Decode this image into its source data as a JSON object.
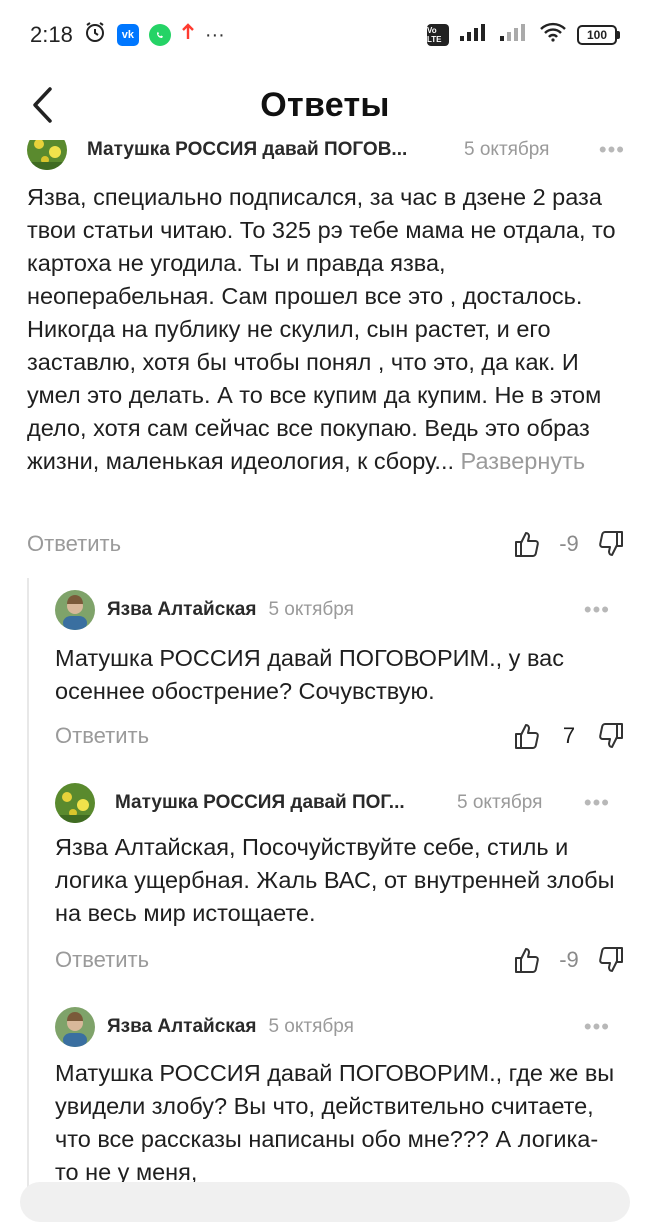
{
  "status_bar": {
    "time": "2:18",
    "more": "···",
    "battery": "100",
    "lte": "Vo LTE"
  },
  "header": {
    "title": "Ответы"
  },
  "comments": [
    {
      "author": "Матушка РОССИЯ давай ПОГОВ...",
      "date": "5 октября",
      "text": "Язва, специально подписался, за час в дзене 2 раза твои статьи читаю. То 325 рэ тебе мама не отдала, то картоха не угодила. Ты и правда язва, неоперабельная. Сам прошел все это , досталось. Никогда на публику не скулил, сын растет, и его заставлю, хотя бы чтобы понял , что это, да как. И умел это делать. А то все купим да купим. Не в этом дело, хотя сам сейчас все покупаю. Ведь это образ жизни, маленькая идеология, к сбору...",
      "expand": "Развернуть",
      "reply": "Ответить",
      "score": "-9"
    },
    {
      "author": "Язва Алтайская",
      "date": "5 октября",
      "text": "Матушка РОССИЯ давай ПОГОВОРИМ., у вас осеннее обострение? Сочувствую.",
      "reply": "Ответить",
      "score": "7"
    },
    {
      "author": "Матушка РОССИЯ давай ПОГ...",
      "date": "5 октября",
      "text": "Язва Алтайская, Посочуйствуйте себе, стиль и логика ущербная. Жаль ВАС, от внутренней злобы на весь мир истощаете.",
      "reply": "Ответить",
      "score": "-9"
    },
    {
      "author": "Язва Алтайская",
      "date": "5 октября",
      "text": "Матушка РОССИЯ давай ПОГОВОРИМ., где же вы увидели злобу? Вы что, действительно считаете, что все рассказы написаны обо мне??? А логика- то не у меня,"
    }
  ],
  "colors": {
    "text": "#1f1f1f",
    "muted": "#9a9a9a",
    "vk": "#0077ff",
    "whatsapp": "#25d366",
    "upload": "#ff3b30"
  }
}
